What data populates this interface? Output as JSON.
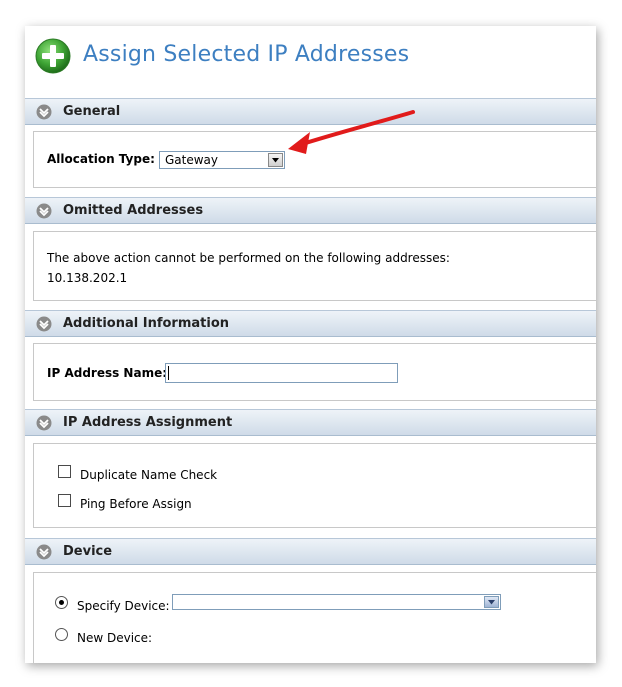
{
  "page": {
    "title": "Assign Selected IP Addresses"
  },
  "sections": {
    "general": {
      "header": "General",
      "allocation_label": "Allocation Type:",
      "allocation_value": "Gateway"
    },
    "omitted": {
      "header": "Omitted Addresses",
      "message": "The above action cannot be performed on the following addresses:",
      "addresses": [
        "10.138.202.1"
      ]
    },
    "additional": {
      "header": "Additional Information",
      "ip_name_label": "IP Address Name:",
      "ip_name_value": ""
    },
    "assignment": {
      "header": "IP Address Assignment",
      "options": [
        {
          "label": "Duplicate Name Check",
          "checked": false
        },
        {
          "label": "Ping Before Assign",
          "checked": false
        }
      ]
    },
    "device": {
      "header": "Device",
      "specify_label": "Specify Device:",
      "specify_value": "",
      "new_label": "New Device:",
      "selected": "specify"
    }
  },
  "colors": {
    "title": "#3d7fc1",
    "arrow": "#e11b1b",
    "plus": "#3fa535"
  },
  "icons": [
    "plus-icon",
    "chevron-down-icon",
    "dropdown-arrow-icon",
    "red-arrow-annotation"
  ]
}
